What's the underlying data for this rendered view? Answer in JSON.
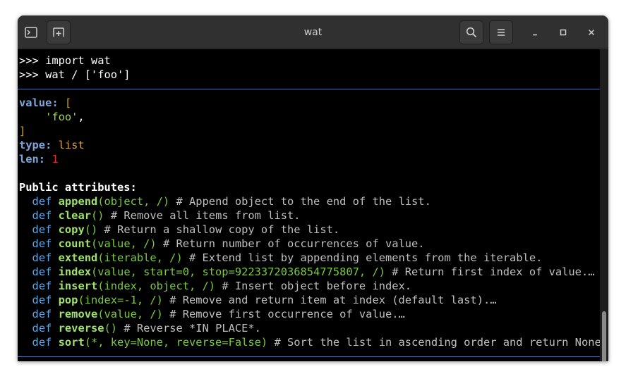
{
  "window": {
    "title": "wat"
  },
  "titlebar": {
    "new_tab_icon": "terminal-icon",
    "split_icon": "new-tab-icon",
    "search_icon": "search-icon",
    "menu_icon": "hamburger-menu-icon",
    "minimize_glyph": "–",
    "maximize_glyph": "□",
    "close_glyph": "✕"
  },
  "colors": {
    "terminal_bg": "#000000",
    "titlebar_bg": "#303030",
    "keyword": "#5fa8e8",
    "method_name": "#9ee26a",
    "args": "#79c93e",
    "comment": "#bfbfbf",
    "label": "#7fa5d8",
    "separator": "#4a6aa8"
  },
  "terminal": {
    "commands": [
      ">>> import wat",
      ">>> wat / ['foo']"
    ],
    "value_label": "value:",
    "value_open": "[",
    "value_item": "'foo'",
    "value_item_comma": ",",
    "value_close": "]",
    "type_label": "type:",
    "type_value": "list",
    "len_label": "len:",
    "len_value": "1",
    "public_attrs_heading": "Public attributes:",
    "methods": [
      {
        "kw": "def",
        "name": "append",
        "args": "(object, /)",
        "comment": "# Append object to the end of the list."
      },
      {
        "kw": "def",
        "name": "clear",
        "args": "()",
        "comment": "# Remove all items from list."
      },
      {
        "kw": "def",
        "name": "copy",
        "args": "()",
        "comment": "# Return a shallow copy of the list."
      },
      {
        "kw": "def",
        "name": "count",
        "args": "(value, /)",
        "comment": "# Return number of occurrences of value."
      },
      {
        "kw": "def",
        "name": "extend",
        "args": "(iterable, /)",
        "comment": "# Extend list by appending elements from the iterable."
      },
      {
        "kw": "def",
        "name": "index",
        "args": "(value, start=0, stop=9223372036854775807, /)",
        "comment": "# Return first index of value.…"
      },
      {
        "kw": "def",
        "name": "insert",
        "args": "(index, object, /)",
        "comment": "# Insert object before index."
      },
      {
        "kw": "def",
        "name": "pop",
        "args": "(index=-1, /)",
        "comment": "# Remove and return item at index (default last).…"
      },
      {
        "kw": "def",
        "name": "remove",
        "args": "(value, /)",
        "comment": "# Remove first occurrence of value.…"
      },
      {
        "kw": "def",
        "name": "reverse",
        "args": "()",
        "comment": "# Reverse *IN PLACE*."
      },
      {
        "kw": "def",
        "name": "sort",
        "args": "(*, key=None, reverse=False)",
        "comment": "# Sort the list in ascending order and return None.…"
      }
    ]
  }
}
